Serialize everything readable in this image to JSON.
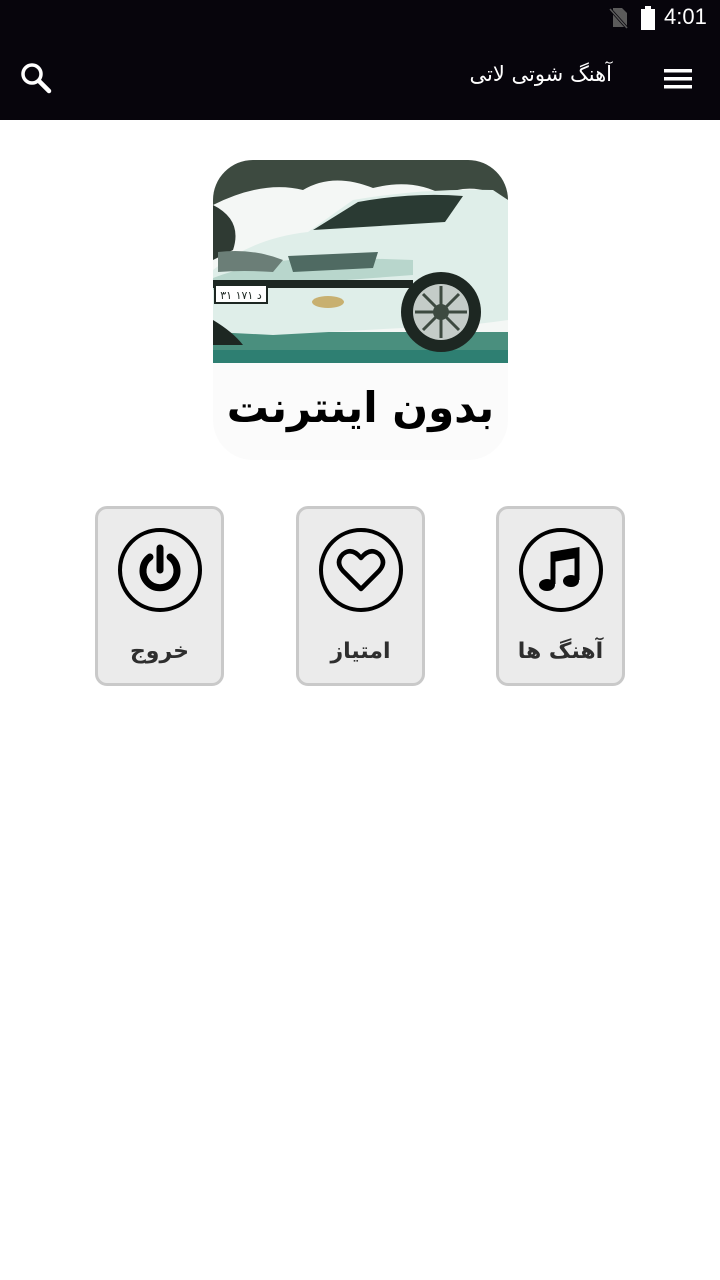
{
  "status_bar": {
    "time": "4:01"
  },
  "toolbar": {
    "title": "آهنگ شوتی لاتی"
  },
  "banner": {
    "caption": "بدون اینترنت",
    "plate_text": "۳۱ ۱۷۱ د"
  },
  "tiles": [
    {
      "label": "خروج",
      "icon": "power-icon"
    },
    {
      "label": "امتیاز",
      "icon": "heart-icon"
    },
    {
      "label": "آهنگ ها",
      "icon": "music-note-icon"
    }
  ],
  "colors": {
    "bar_background": "#07050c",
    "tile_background": "#ebebeb",
    "tile_border": "#c9c9c9"
  }
}
